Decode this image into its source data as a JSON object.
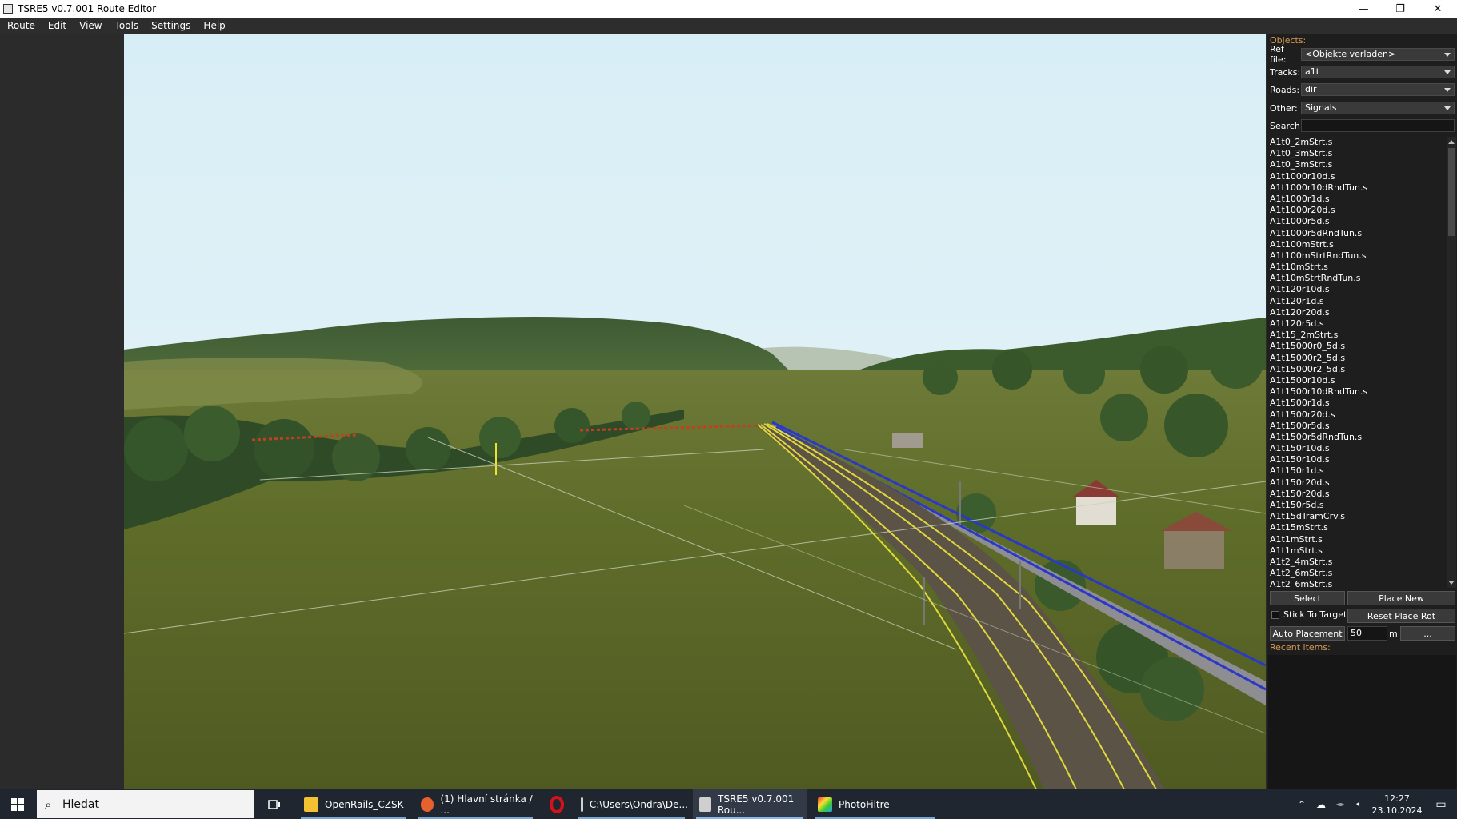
{
  "window": {
    "title": "TSRE5 v0.7.001 Route Editor",
    "controls": {
      "minimize": "—",
      "maximize": "❐",
      "close": "✕"
    }
  },
  "menubar": [
    {
      "label": "Route",
      "accel": "R",
      "rest": "oute"
    },
    {
      "label": "Edit",
      "accel": "E",
      "rest": "dit"
    },
    {
      "label": "View",
      "accel": "V",
      "rest": "iew"
    },
    {
      "label": "Tools",
      "accel": "T",
      "rest": "ools"
    },
    {
      "label": "Settings",
      "accel": "S",
      "rest": "ettings"
    },
    {
      "label": "Help",
      "accel": "H",
      "rest": "elp"
    }
  ],
  "panel": {
    "objects_label": "Objects:",
    "ref_file": {
      "label": "Ref file:",
      "value": "<Objekte verladen>"
    },
    "tracks": {
      "label": "Tracks:",
      "value": "a1t"
    },
    "roads": {
      "label": "Roads:",
      "value": "dir"
    },
    "other": {
      "label": "Other:",
      "value": "Signals"
    },
    "search": {
      "label": "Search:",
      "value": ""
    },
    "items": [
      "A1t0_2mStrt.s",
      "A1t0_3mStrt.s",
      "A1t0_3mStrt.s",
      "A1t1000r10d.s",
      "A1t1000r10dRndTun.s",
      "A1t1000r1d.s",
      "A1t1000r20d.s",
      "A1t1000r5d.s",
      "A1t1000r5dRndTun.s",
      "A1t100mStrt.s",
      "A1t100mStrtRndTun.s",
      "A1t10mStrt.s",
      "A1t10mStrtRndTun.s",
      "A1t120r10d.s",
      "A1t120r1d.s",
      "A1t120r20d.s",
      "A1t120r5d.s",
      "A1t15_2mStrt.s",
      "A1t15000r0_5d.s",
      "A1t15000r2_5d.s",
      "A1t15000r2_5d.s",
      "A1t1500r10d.s",
      "A1t1500r10dRndTun.s",
      "A1t1500r1d.s",
      "A1t1500r20d.s",
      "A1t1500r5d.s",
      "A1t1500r5dRndTun.s",
      "A1t150r10d.s",
      "A1t150r10d.s",
      "A1t150r1d.s",
      "A1t150r20d.s",
      "A1t150r20d.s",
      "A1t150r5d.s",
      "A1t15dTramCrv.s",
      "A1t15mStrt.s",
      "A1t1mStrt.s",
      "A1t1mStrt.s",
      "A1t2_4mStrt.s",
      "A1t2_6mStrt.s",
      "A1t2_6mStrt.s"
    ],
    "select_button": "Select",
    "place_new_button": "Place New",
    "stick_to_target": "Stick To Target",
    "reset_place_rot_button": "Reset Place Rot",
    "auto_placement_button": "Auto Placement",
    "auto_placement_distance": "50",
    "distance_unit": "m",
    "more_button": "...",
    "recent_items_label": "Recent items:"
  },
  "taskbar": {
    "search_placeholder": "Hledat",
    "tasks": [
      {
        "label": "OpenRails_CZSK",
        "icon": "folder-icon",
        "color": "#f2c233"
      },
      {
        "label": "(1) Hlavní stránka / ...",
        "icon": "firefox-icon",
        "color": "#e8612c"
      },
      {
        "label": "",
        "icon": "opera-icon",
        "color": "#d7111b"
      },
      {
        "label": "C:\\Users\\Ondra\\De...",
        "icon": "explorer-window-icon",
        "color": "#cfcfcf"
      },
      {
        "label": "TSRE5 v0.7.001 Rou...",
        "icon": "tsre-icon",
        "color": "#cfcfcf"
      },
      {
        "label": "PhotoFiltre",
        "icon": "photofiltre-icon",
        "color": "#4aa0d8"
      }
    ],
    "time": "12:27",
    "date": "23.10.2024"
  }
}
